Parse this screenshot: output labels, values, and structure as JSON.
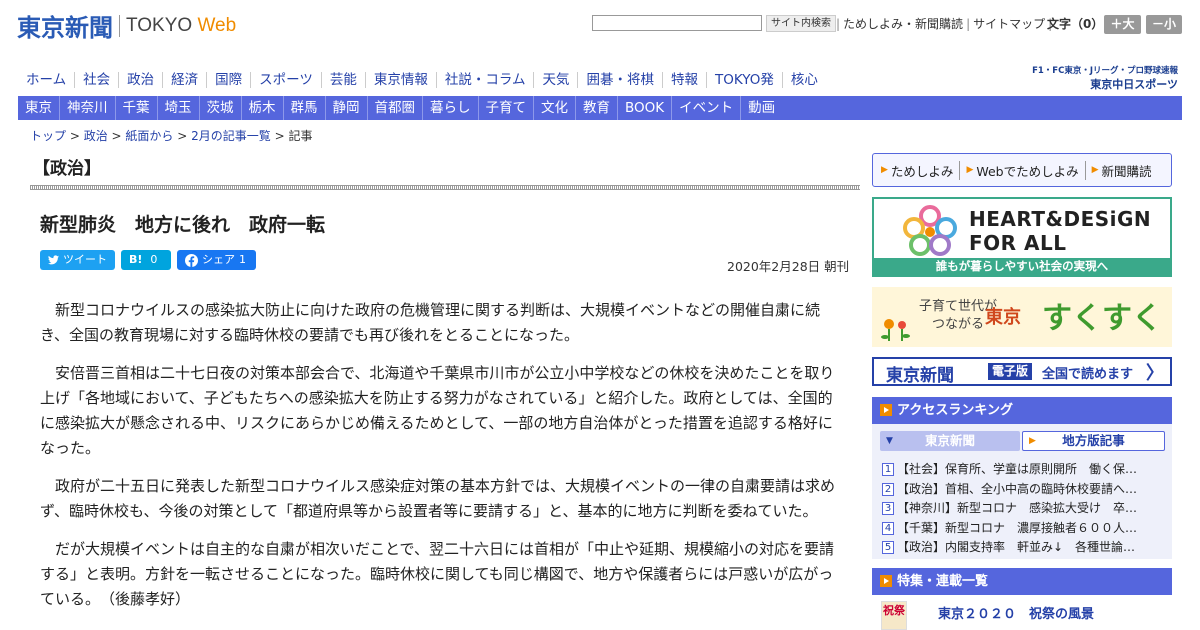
{
  "header": {
    "logo_jp": "東京新聞",
    "logo_en": "TOKYO",
    "logo_web": "Web",
    "search_button": "サイト内検索",
    "links": [
      "ためしよみ・新聞購読",
      "サイトマップ"
    ],
    "fontsize_label": "文字（0）",
    "font_bigger": "＋大",
    "font_smaller": "－小"
  },
  "nav_main": [
    "ホーム",
    "社会",
    "政治",
    "経済",
    "国際",
    "スポーツ",
    "芸能",
    "東京情報",
    "社説・コラム",
    "天気",
    "囲碁・将棋",
    "特報",
    "TOKYO発",
    "核心"
  ],
  "chunichi": {
    "line1": "F1・FC東京・Jリーグ・プロ野球速報",
    "line2": "東京中日スポーツ"
  },
  "nav_region": [
    "東京",
    "神奈川",
    "千葉",
    "埼玉",
    "茨城",
    "栃木",
    "群馬",
    "静岡",
    "首都圏",
    "暮らし",
    "子育て",
    "文化",
    "教育",
    "BOOK",
    "イベント",
    "動画"
  ],
  "breadcrumb": [
    "トップ",
    "政治",
    "紙面から",
    "2月の記事一覧",
    "記事"
  ],
  "breadcrumb_sep": " > ",
  "section_title": "【政治】",
  "article": {
    "headline": "新型肺炎　地方に後れ　政府一転",
    "share_tweet": "ツイート",
    "share_hatena": "B!",
    "share_hatena_count": "0",
    "share_facebook": "シェア",
    "share_facebook_count": "1",
    "date": "2020年2月28日 朝刊",
    "paragraphs": [
      "新型コロナウイルスの感染拡大防止に向けた政府の危機管理に関する判断は、大規模イベントなどの開催自粛に続き、全国の教育現場に対する臨時休校の要請でも再び後れをとることになった。",
      "安倍晋三首相は二十七日夜の対策本部会合で、北海道や千葉県市川市が公立小中学校などの休校を決めたことを取り上げ「各地域において、子どもたちへの感染拡大を防止する努力がなされている」と紹介した。政府としては、全国的に感染拡大が懸念される中、リスクにあらかじめ備えるためとして、一部の地方自治体がとった措置を追認する格好になった。",
      "政府が二十五日に発表した新型コロナウイルス感染症対策の基本方針では、大規模イベントの一律の自粛要請は求めず、臨時休校も、今後の対策として「都道府県等から設置者等に要請する」と、基本的に地方に判断を委ねていた。",
      "だが大規模イベントは自主的な自粛が相次いだことで、翌二十六日には首相が「中止や延期、規模縮小の対応を要請する」と表明。方針を一転させることになった。臨時休校に関しても同じ構図で、地方や保護者らには戸惑いが広がっている。　（後藤孝好）"
    ]
  },
  "sidebar": {
    "quick_links": [
      "ためしよみ",
      "Webでためしよみ",
      "新聞購読"
    ],
    "banner_hd": {
      "line1": "HEART&DESiGN",
      "line2": "FOR ALL",
      "caption": "誰もが暮らしやすい社会の実現へ"
    },
    "banner_sukusuku": {
      "line1": "子育て世代が",
      "line2": "つながる",
      "city": "東京",
      "name": "すくすく"
    },
    "banner_digital": {
      "brand": "東京新聞",
      "badge": "電子版",
      "text": "全国で読めます",
      "arrow": "〉"
    },
    "ranking": {
      "title": "アクセスランキング",
      "tab_active": "東京新聞",
      "tab_inactive": "地方版記事",
      "items": [
        {
          "num": "1",
          "text": "【社会】保育所、学童は原則開所　働く保…"
        },
        {
          "num": "2",
          "text": "【政治】首相、全小中高の臨時休校要請へ…"
        },
        {
          "num": "3",
          "text": "【神奈川】新型コロナ　感染拡大受け　卒…"
        },
        {
          "num": "4",
          "text": "【千葉】新型コロナ　濃厚接触者６００人…"
        },
        {
          "num": "5",
          "text": "【政治】内閣支持率　軒並み↓　各種世論…"
        }
      ]
    },
    "features": {
      "title": "特集・連載一覧",
      "thumb": "祝祭",
      "item_title": "東京２０２０　祝祭の風景"
    }
  },
  "colors": {
    "brand_blue": "#2541a8",
    "nav_blue": "#5566dd",
    "accent_orange": "#f08c00",
    "hd_green": "#3aa98a"
  }
}
